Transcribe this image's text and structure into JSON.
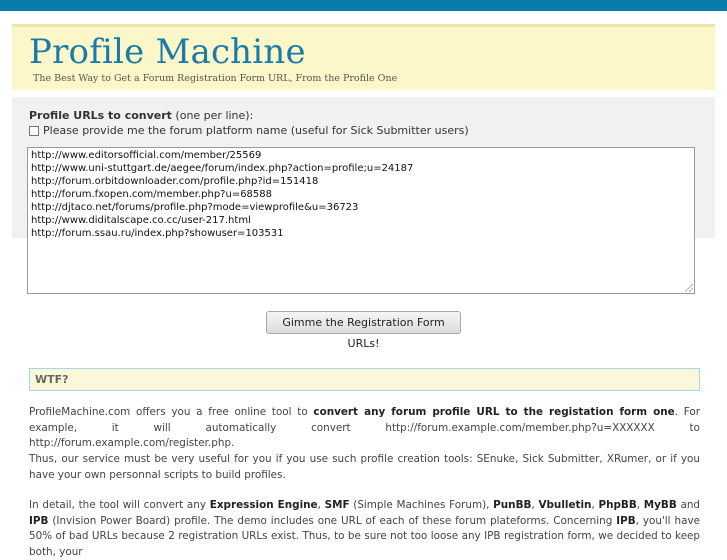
{
  "header": {
    "title": "Profile Machine",
    "tagline": "The Best Way to Get a Forum Registration Form URL, From the Profile One"
  },
  "form": {
    "label_bold": "Profile URLs to convert",
    "label_rest": " (one per line):",
    "checkbox_label": "Please provide me the forum platform name (useful for Sick Submitter users)",
    "checkbox_checked": false,
    "urls": [
      "http://www.editorsofficial.com/member/25569",
      "http://www.uni-stuttgart.de/aegee/forum/index.php?action=profile;u=24187",
      "http://forum.orbitdownloader.com/profile.php?id=151418",
      "http://forum.fxopen.com/member.php?u=68588",
      "http://djtaco.net/forums/profile.php?mode=viewprofile&u=36723",
      "http://www.diditalscape.co.cc/user-217.html",
      "http://forum.ssau.ru/index.php?showuser=103531"
    ],
    "submit_label": "Gimme the Registration Form URLs!"
  },
  "wtf": {
    "heading": "WTF?",
    "p1": {
      "a": "ProfileMachine.com offers you a free online tool to ",
      "b": "convert any forum profile URL to the registation form one",
      "c": ". For example, it will automatically convert http://forum.example.com/member.php?u=XXXXXX to http://forum.example.com/register.php."
    },
    "p2": "Thus, our service must be very useful for you if you use such profile creation tools: SEnuke, Sick Submitter, XRumer, or if you have your own personnal scripts to build profiles.",
    "p3": {
      "t1": "In detail, the tool will convert any ",
      "b1": "Expression Engine",
      "t2": ", ",
      "b2": "SMF",
      "t3": " (Simple Machines Forum), ",
      "b3": "PunBB",
      "t4": ", ",
      "b4": "Vbulletin",
      "t5": ", ",
      "b5": "PhpBB",
      "t6": ", ",
      "b6": "MyBB",
      "t7": " and ",
      "b7": "IPB",
      "t8": " (Invision Power Board) profile. The demo includes one URL of each of these forum plateforms. Concerning ",
      "b8": "IPB",
      "t9": ", you'll have 50% of bad URLs because 2 registration URLs exist. Thus, to be sure not too loose any IPB registration form, we decided to keep both, your"
    }
  }
}
